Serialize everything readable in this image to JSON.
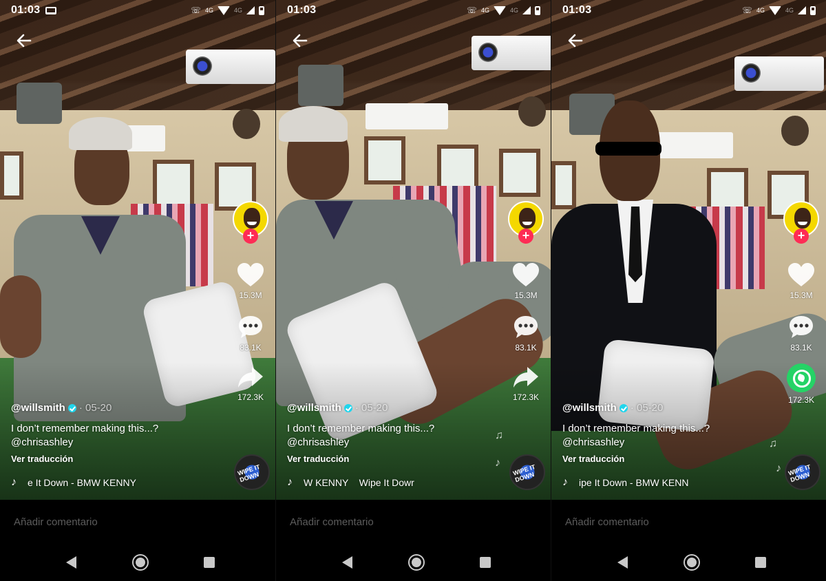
{
  "panels": [
    {
      "status": {
        "time": "01:03",
        "net1": "4G",
        "net2": "4G"
      },
      "author": {
        "handle": "@willsmith",
        "date": "· 05-20"
      },
      "description": "I don’t remember making this...?",
      "mention": "@chrisashley",
      "translate_label": "Ver traducción",
      "music": "e It Down - BMW KENNY",
      "likes": "15.3M",
      "comments": "83.1K",
      "shares": "172.3K",
      "share_icon": "share-arrow-icon",
      "comment_placeholder": "Añadir comentario",
      "disc_label": "WIPE IT DOWN"
    },
    {
      "status": {
        "time": "01:03",
        "net1": "4G",
        "net2": "4G"
      },
      "author": {
        "handle": "@willsmith",
        "date": "· 05-20"
      },
      "description": "I don’t remember making this...?",
      "mention": "@chrisashley",
      "translate_label": "Ver traducción",
      "music": "W KENNY    Wipe It Dowr",
      "likes": "15.3M",
      "comments": "83.1K",
      "shares": "172.3K",
      "share_icon": "share-arrow-icon",
      "comment_placeholder": "Añadir comentario",
      "disc_label": "WIPE IT DOWN"
    },
    {
      "status": {
        "time": "01:03",
        "net1": "4G",
        "net2": "4G"
      },
      "author": {
        "handle": "@willsmith",
        "date": "· 05-20"
      },
      "description": "I don’t remember making this...?",
      "mention": "@chrisashley",
      "translate_label": "Ver traducción",
      "music": "ipe It Down - BMW KENN",
      "likes": "15.3M",
      "comments": "83.1K",
      "shares": "172.3K",
      "share_icon": "whatsapp-icon",
      "comment_placeholder": "Añadir comentario",
      "disc_label": "WIPE IT DOWN"
    }
  ],
  "colors": {
    "follow": "#fe2c55",
    "verified": "#20d5ec",
    "whatsapp": "#25d366",
    "avatar_bg": "#f4d800"
  }
}
